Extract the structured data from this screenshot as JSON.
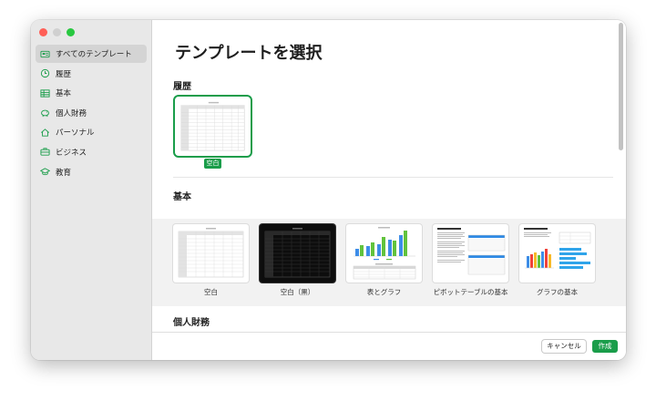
{
  "sidebar": {
    "items": [
      {
        "label": "すべてのテンプレート",
        "icon": "all-templates-icon"
      },
      {
        "label": "履歴",
        "icon": "clock-icon"
      },
      {
        "label": "基本",
        "icon": "table-icon"
      },
      {
        "label": "個人財務",
        "icon": "piggy-bank-icon"
      },
      {
        "label": "パーソナル",
        "icon": "house-icon"
      },
      {
        "label": "ビジネス",
        "icon": "briefcase-icon"
      },
      {
        "label": "教育",
        "icon": "graduation-cap-icon"
      }
    ]
  },
  "main": {
    "title": "テンプレートを選択",
    "recent": {
      "heading": "履歴",
      "badge": "空白"
    },
    "basic": {
      "heading": "基本",
      "templates": [
        {
          "label": "空白"
        },
        {
          "label": "空白（黒）"
        },
        {
          "label": "表とグラフ"
        },
        {
          "label": "ピボットテーブルの基本"
        },
        {
          "label": "グラフの基本"
        }
      ]
    },
    "personal_finance": {
      "heading": "個人財務"
    }
  },
  "footer": {
    "cancel_label": "キャンセル",
    "create_label": "作成"
  },
  "colors": {
    "accent": "#1a9d4a",
    "sidebar_bg": "#e8e8e8"
  }
}
